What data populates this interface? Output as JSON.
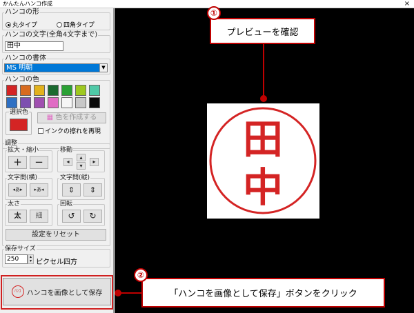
{
  "window": {
    "title": "かんたんハンコ作成",
    "close": "×"
  },
  "shape": {
    "group_label": "ハンコの形",
    "opt_round": "丸タイプ",
    "opt_square": "四角タイプ"
  },
  "text": {
    "label": "ハンコの文字(全角4文字まで)",
    "value": "田中"
  },
  "font": {
    "label": "ハンコの書体",
    "value": "MS 明朝"
  },
  "color": {
    "label": "ハンコの色",
    "swatches": [
      "#d42424",
      "#d86b1e",
      "#e2b21d",
      "#1b6a2f",
      "#2aa034",
      "#9ec81f",
      "#4fc9a7",
      "#2d6fc3",
      "#7d4fb0",
      "#a04fb0",
      "#e06cc4",
      "#f6f6f6",
      "#c8c8c8",
      "#0a0a0a"
    ],
    "selected_label": "選択色",
    "selected_color": "#d42424",
    "make_color_button": "色を作成する",
    "ink_blur_check": "インクの擦れを再現"
  },
  "adjust": {
    "label": "調整",
    "scale_label": "拡大・縮小",
    "plus": "+",
    "minus": "−",
    "move_label": "移動",
    "move_arrows": [
      "◂",
      "▴",
      "▾",
      "▸"
    ],
    "spacing_h_label": "文字間(横)",
    "spacing_v_label": "文字間(縦)",
    "spacing_h_glyphs": [
      "◂あ▸",
      "▸あ◂"
    ],
    "spacing_v_glyphs": [
      "⇕",
      "⇕"
    ],
    "weight_label": "太さ",
    "bold": "太",
    "thin": "細",
    "rotate_label": "回転",
    "rotate_glyphs": [
      "↺",
      "↻"
    ],
    "reset_button": "設定をリセット"
  },
  "save_size": {
    "label": "保存サイズ",
    "value": "250",
    "unit": "ピクセル四方"
  },
  "save_button": {
    "icon_text": "ﾊﾝｺ",
    "label": "ハンコを画像として保存"
  },
  "stamp": {
    "chars": [
      "田",
      "中"
    ],
    "color": "#d42424"
  },
  "callouts": {
    "one": {
      "number": "①",
      "text": "プレビューを確認"
    },
    "two": {
      "number": "②",
      "text": "「ハンコを画像として保存」ボタンをクリック"
    }
  }
}
